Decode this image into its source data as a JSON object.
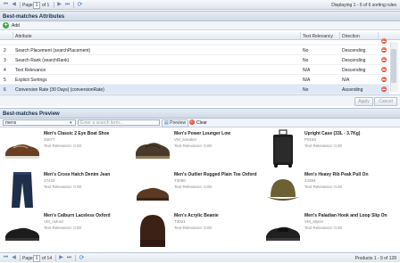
{
  "top_pager": {
    "page_label": "Page",
    "page_value": "1",
    "of_label": "of 1",
    "status": "Displaying 1 - 6 of 6 sorting rules"
  },
  "attributes_panel": {
    "title": "Best-matches Attributes",
    "add_label": "Add",
    "columns": {
      "attribute": "Attribute",
      "relevancy": "Text Relevancy",
      "direction": "Direction"
    },
    "rows": [
      {
        "num": "",
        "attribute": "",
        "relevancy": "",
        "direction": ""
      },
      {
        "num": "2",
        "attribute": "Search Placement (searchPlacement)",
        "relevancy": "No",
        "direction": "Descending"
      },
      {
        "num": "3",
        "attribute": "Search Rank (searchRank)",
        "relevancy": "No",
        "direction": "Descending"
      },
      {
        "num": "4",
        "attribute": "Text Relevance",
        "relevancy": "N/A",
        "direction": "Descending"
      },
      {
        "num": "5",
        "attribute": "Explicit Sortings",
        "relevancy": "N/A",
        "direction": "N/A"
      },
      {
        "num": "6",
        "attribute": "Conversion Rate (30 Days) (conversionRate)",
        "relevancy": "No",
        "direction": "Ascending"
      }
    ],
    "apply_label": "Apply",
    "cancel_label": "Cancel"
  },
  "preview_panel": {
    "title": "Best-matches Preview",
    "category_value": "mens",
    "search_placeholder": "Enter a search term...",
    "preview_label": "Preview",
    "clear_label": "Clear",
    "products": [
      {
        "name": "Men's Classic 2 Eye Boat Shoe",
        "sku": "25077",
        "relevance": "Text Relevance: 0.00",
        "image": "brown-boat-shoe"
      },
      {
        "name": "Men's Power Lounger Low",
        "sku": "VM_sneaker",
        "relevance": "Text Relevance: 0.00",
        "image": "dark-sneaker"
      },
      {
        "name": "Upright Case (33L - 3.7Kg)",
        "sku": "P0150",
        "relevance": "Text Relevance: 0.00",
        "image": "black-suitcase"
      },
      {
        "name": "Men's Cross Hatch Denim Jean",
        "sku": "27433",
        "relevance": "Text Relevance: 0.00",
        "image": "denim-jeans"
      },
      {
        "name": "Men's Outlier Rugged Plain Toe Oxford",
        "sku": "T3050",
        "relevance": "Text Relevance: 0.00",
        "image": "brown-oxford"
      },
      {
        "name": "Men's Heavy Rib Peak Pull On",
        "sku": "24384",
        "relevance": "Text Relevance: 0.00",
        "image": "olive-hat"
      },
      {
        "name": "Men's Calburn Laceless Oxford",
        "sku": "VM_oxford",
        "relevance": "Text Relevance: 0.00",
        "image": "black-oxford"
      },
      {
        "name": "Men's Acrylic Beanie",
        "sku": "T3021",
        "relevance": "Text Relevance: 0.00",
        "image": "brown-beanie"
      },
      {
        "name": "Men's Paladian Hook and Loop Slip On",
        "sku": "VM_slipon",
        "relevance": "Text Relevance: 0.00",
        "image": "black-slipon"
      }
    ]
  },
  "bottom_pager": {
    "page_label": "Page",
    "page_value": "1",
    "of_label": "of 14",
    "status": "Products 1 - 9 of 128"
  }
}
